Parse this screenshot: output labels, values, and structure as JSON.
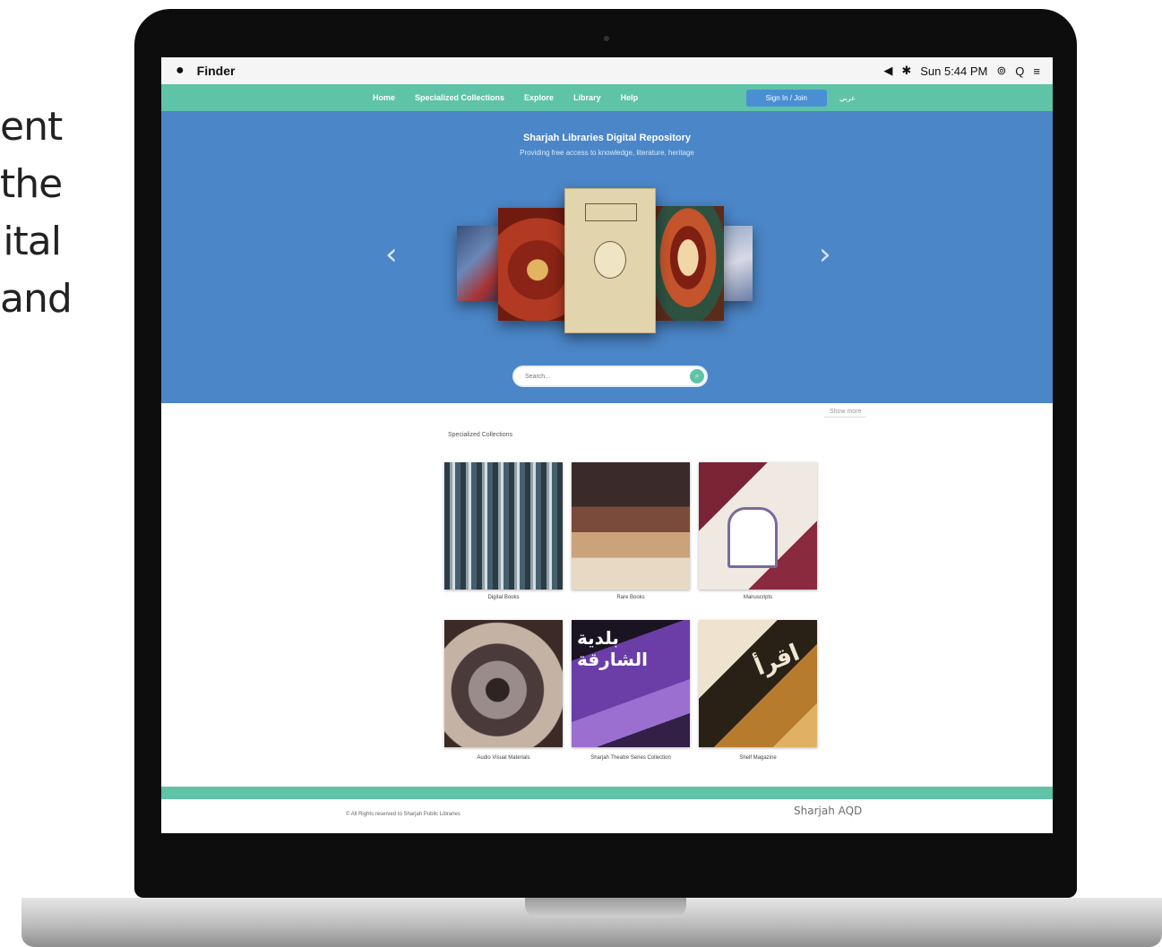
{
  "side_text": [
    "ent",
    "the",
    "ital",
    "and"
  ],
  "menubar": {
    "apple_icon": "",
    "app_name": "Finder",
    "status": [
      "◀",
      "✱",
      "Sun 5:44 PM",
      "⊚",
      "Q",
      "≡"
    ]
  },
  "nav": {
    "links": [
      "Home",
      "Specialized Collections",
      "Explore",
      "Library",
      "Help"
    ],
    "login_label": "Sign In / Join",
    "extra_label": "عربي"
  },
  "hero": {
    "title": "Sharjah Libraries Digital Repository",
    "subtitle": "Providing free access to knowledge, literature, heritage",
    "prev_arrow": "‹",
    "next_arrow": "›"
  },
  "search": {
    "placeholder": "Search...",
    "button_icon": "search-icon"
  },
  "collections": {
    "title": "Specialized Collections",
    "top_link": "Show more",
    "items": [
      {
        "label": "Digital Books"
      },
      {
        "label": "Rare Books"
      },
      {
        "label": "Manuscripts"
      },
      {
        "label": "Audio Visual Materials"
      },
      {
        "label": "Sharjah Theatre Series Collection"
      },
      {
        "label": "Shelf Magazine"
      }
    ],
    "card_texts": [
      "بلدية الشارقة",
      "اقرأ"
    ]
  },
  "footer": {
    "copyright": "© All Rights reserved to Sharjah Public Libraries",
    "logo_text": "Sharjah AQD"
  },
  "colors": {
    "nav_green": "#5fc3a7",
    "hero_blue": "#4b86c8",
    "button_blue": "#4a8fd4"
  }
}
